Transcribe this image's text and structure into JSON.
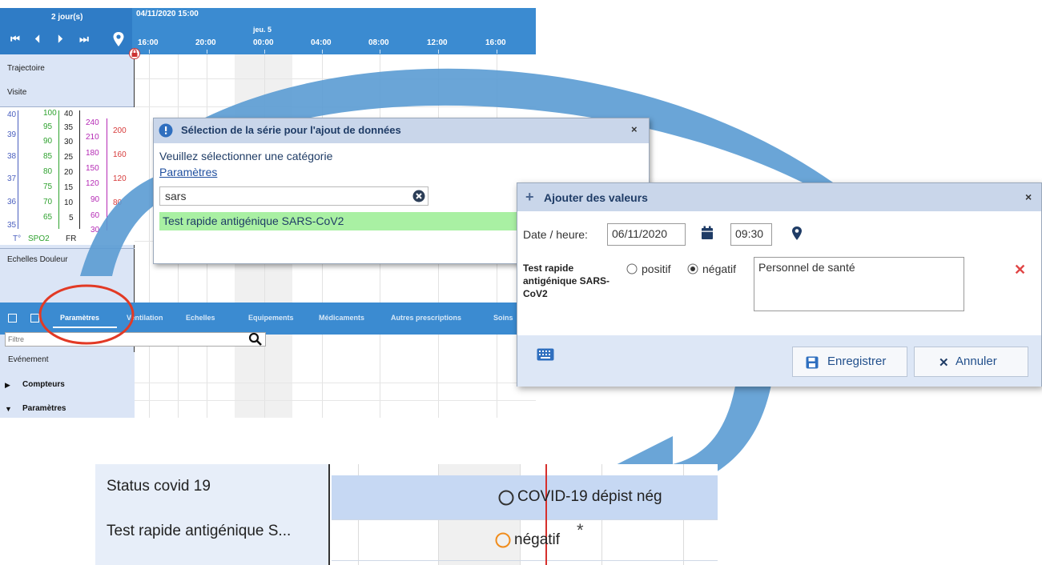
{
  "timeline": {
    "days": "2 jour(s)",
    "datetime": "04/11/2020  15:00",
    "day_marker": "jeu. 5",
    "ticks": [
      "16:00",
      "20:00",
      "00:00",
      "04:00",
      "08:00",
      "12:00",
      "16:00"
    ],
    "nav": [
      "skip-start-icon",
      "prev-icon",
      "next-icon",
      "skip-end-icon",
      "location-pin-icon"
    ],
    "rows": {
      "trajectoire": "Trajectoire",
      "visite": "Visite",
      "echelles": "Echelles Douleur"
    },
    "scales": {
      "temp": [
        "40",
        "39",
        "38",
        "37",
        "36",
        "35"
      ],
      "spo2": [
        "100",
        "95",
        "90",
        "85",
        "80",
        "75",
        "70",
        "65"
      ],
      "fr": [
        "40",
        "35",
        "30",
        "25",
        "20",
        "15",
        "10",
        "5"
      ],
      "pink": [
        "240",
        "210",
        "180",
        "150",
        "120",
        "90",
        "60",
        "30"
      ],
      "red": [
        "200",
        "160",
        "120",
        "80"
      ],
      "labels": {
        "temp": "T°",
        "spo2": "SPO2",
        "fr": "FR"
      }
    },
    "tabs": [
      "Paramètres",
      "Ventilation",
      "Echelles",
      "Equipements",
      "Médicaments",
      "Autres prescriptions",
      "Soins"
    ],
    "filter_placeholder": "Filtre",
    "events": {
      "header": "Evénement",
      "compteurs": "Compteurs",
      "parametres": "Paramètres"
    },
    "colors": {
      "bar": "#3b8bd1",
      "temp": "#4a5fbf",
      "spo2": "#2fa22f",
      "fr": "#222222",
      "pink": "#b52ab5",
      "red": "#d73a3a"
    }
  },
  "dialog1": {
    "title": "Sélection de la série pour l'ajout de données",
    "prompt": "Veuillez sélectionner une catégorie",
    "category": "Paramètres",
    "search_value": "sars",
    "result": "Test rapide antigénique SARS-CoV2"
  },
  "dialog2": {
    "title": "Ajouter des valeurs",
    "date_label": "Date / heure:",
    "date": "06/11/2020",
    "time": "09:30",
    "param_label": "Test rapide antigénique SARS-CoV2",
    "opt_pos": "positif",
    "opt_neg": "négatif",
    "selected": "négatif",
    "comment": "Personnel de santé",
    "save": "Enregistrer",
    "cancel": "Annuler"
  },
  "bottom": {
    "row1_label": "Status covid 19",
    "row2_label": "Test rapide antigénique S...",
    "row1_value": "COVID-19 dépist nég",
    "row2_value": "négatif",
    "asterisk": "*"
  }
}
